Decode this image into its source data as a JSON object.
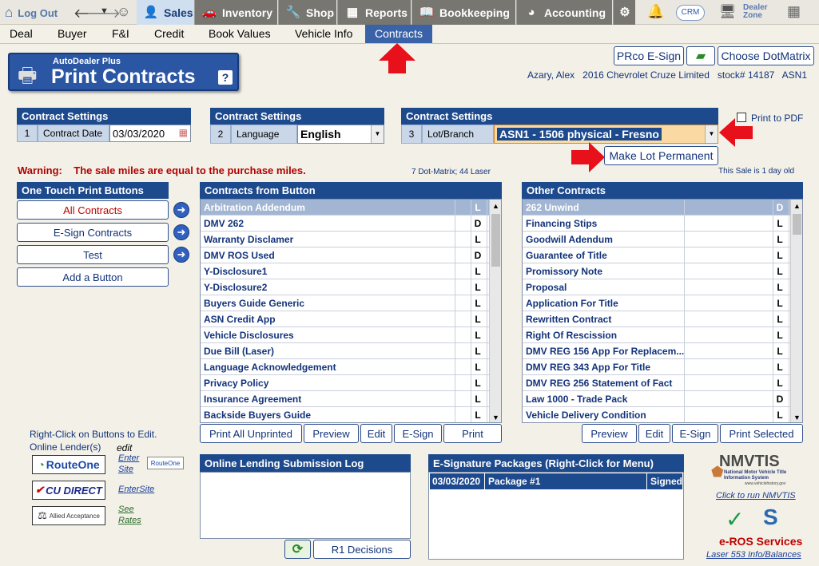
{
  "nav": {
    "logout": "Log Out",
    "tabs": [
      {
        "label": "Sales"
      },
      {
        "label": "Inventory"
      },
      {
        "label": "Shop"
      },
      {
        "label": "Reports"
      },
      {
        "label": "Bookkeeping"
      },
      {
        "label": "Accounting"
      }
    ],
    "crm": "CRM",
    "dealer_zone": "Dealer Zone"
  },
  "subnav": [
    "Deal",
    "Buyer",
    "F&I",
    "Credit",
    "Book Values",
    "Vehicle Info",
    "Contracts"
  ],
  "title": {
    "small": "AutoDealer Plus",
    "big": "Print Contracts",
    "help": "?"
  },
  "top_buttons": {
    "esign": "PRco E-Sign",
    "dotmatrix": "Choose DotMatrix"
  },
  "deal_info": {
    "buyer": "Azary, Alex",
    "vehicle": "2016 Chevrolet Cruze Limited",
    "stock": "stock# 14187",
    "branch": "ASN1"
  },
  "settings": [
    {
      "header": "Contract Settings",
      "num": "1",
      "label": "Contract Date",
      "value": "03/03/2020"
    },
    {
      "header": "Contract Settings",
      "num": "2",
      "label": "Language",
      "value": "English"
    },
    {
      "header": "Contract Settings",
      "num": "3",
      "label": "Lot/Branch",
      "value": "ASN1 - 1506 physical - Fresno"
    }
  ],
  "print_pdf": "Print to PDF",
  "make_lot_permanent": "Make Lot Permanent",
  "warning": {
    "label": "Warning:",
    "text": "The sale miles are equal to the purchase miles."
  },
  "counts": "7 Dot-Matrix; 44 Laser",
  "sale_age": "This Sale is 1 day old",
  "one_touch": {
    "header": "One Touch Print Buttons",
    "buttons": [
      "All Contracts",
      "E-Sign Contracts",
      "Test",
      "Add a Button"
    ]
  },
  "contracts_from_button": {
    "header": "Contracts from Button",
    "rows": [
      {
        "name": "Arbitration Addendum",
        "type": "L"
      },
      {
        "name": "DMV 262",
        "type": "D"
      },
      {
        "name": "Warranty Disclamer",
        "type": "L"
      },
      {
        "name": "DMV ROS Used",
        "type": "D"
      },
      {
        "name": "Y-Disclosure1",
        "type": "L"
      },
      {
        "name": "Y-Disclosure2",
        "type": "L"
      },
      {
        "name": "Buyers Guide Generic",
        "type": "L"
      },
      {
        "name": "ASN Credit App",
        "type": "L"
      },
      {
        "name": "Vehicle Disclosures",
        "type": "L"
      },
      {
        "name": "Due Bill (Laser)",
        "type": "L"
      },
      {
        "name": "Language Acknowledgement",
        "type": "L"
      },
      {
        "name": "Privacy Policy",
        "type": "L"
      },
      {
        "name": "Insurance Agreement",
        "type": "L"
      },
      {
        "name": "Backside Buyers Guide",
        "type": "L"
      }
    ],
    "buttons": [
      "Print All Unprinted",
      "Preview",
      "Edit",
      "E-Sign",
      "Print"
    ]
  },
  "other_contracts": {
    "header": "Other Contracts",
    "rows": [
      {
        "name": "262 Unwind",
        "type": "D"
      },
      {
        "name": "Financing Stips",
        "type": "L"
      },
      {
        "name": "Goodwill Adendum",
        "type": "L"
      },
      {
        "name": "Guarantee of Title",
        "type": "L"
      },
      {
        "name": "Promissory Note",
        "type": "L"
      },
      {
        "name": "Proposal",
        "type": "L"
      },
      {
        "name": "Application For Title",
        "type": "L"
      },
      {
        "name": "Rewritten Contract",
        "type": "L"
      },
      {
        "name": "Right Of Rescission",
        "type": "L"
      },
      {
        "name": "DMV REG 156 App For Replacem...",
        "type": "L"
      },
      {
        "name": "DMV REG 343 App For Title",
        "type": "L"
      },
      {
        "name": "DMV REG 256 Statement of Fact",
        "type": "L"
      },
      {
        "name": "Law 1000 - Trade Pack",
        "type": "D"
      },
      {
        "name": "Vehicle Delivery Condition",
        "type": "L"
      }
    ],
    "buttons": [
      "Preview",
      "Edit",
      "E-Sign",
      "Print Selected"
    ]
  },
  "lenders": {
    "hint": "Right-Click on Buttons to Edit.",
    "title": "Online Lender(s)",
    "edit": "edit",
    "items": [
      {
        "logo": "RouteOne",
        "link1": "Enter",
        "link2": "Site",
        "badge": "RouteOne"
      },
      {
        "logo": "CU DIRECT",
        "link1": "EnterSite"
      },
      {
        "logo": "Allied Acceptance",
        "link1": "See",
        "link2": "Rates"
      }
    ]
  },
  "lending_log": {
    "header": "Online Lending Submission Log",
    "button": "R1 Decisions"
  },
  "esign_packages": {
    "header": "E-Signature Packages (Right-Click for Menu)",
    "rows": [
      {
        "date": "03/03/2020",
        "name": "Package #1",
        "status": "Signed"
      }
    ]
  },
  "nmvtis": {
    "logo": "NMVTIS",
    "sub": "National Motor Vehicle Title Information System",
    "url": "www.vehiclehistory.gov",
    "link": "Click to run NMVTIS"
  },
  "eros": {
    "title": "e-ROS Services",
    "link": "Laser 553 Info/Balances"
  },
  "colors": {
    "nav_dark": "#777670",
    "header_blue": "#1d4a8d",
    "warning_red": "#b00000",
    "arrow_red": "#e8101a"
  }
}
